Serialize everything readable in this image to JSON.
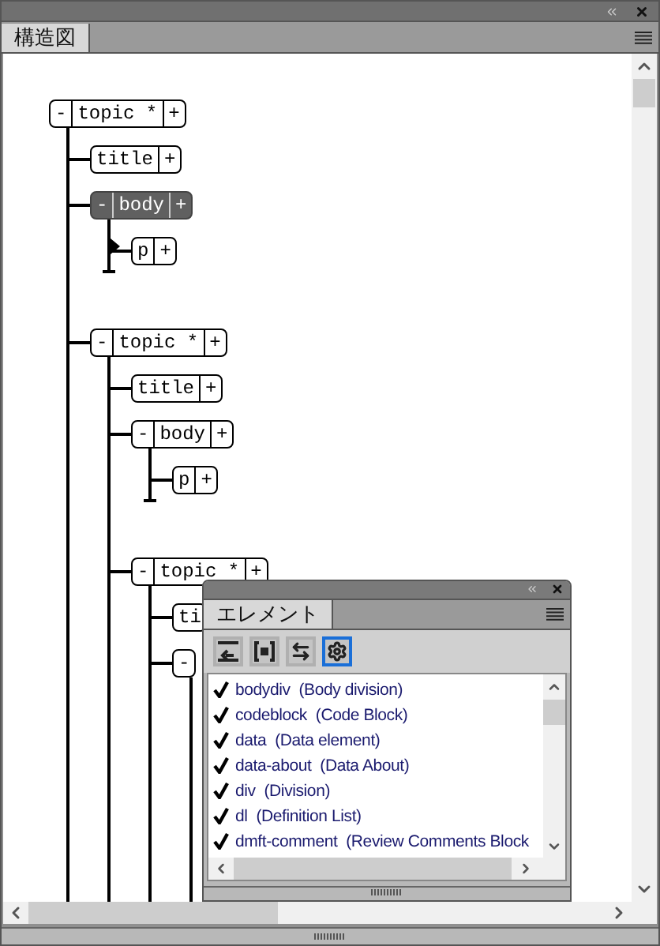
{
  "main_tab": {
    "label": "構造図",
    "selected": true
  },
  "tree": [
    {
      "toggle": "-",
      "label": "topic *",
      "add": "+",
      "selected": false,
      "children": [
        {
          "label": "title",
          "add": "+",
          "selected": false
        },
        {
          "toggle": "-",
          "label": "body",
          "add": "+",
          "selected": true,
          "children": [
            {
              "label": "p",
              "add": "+",
              "selected": false,
              "caret": true
            }
          ]
        },
        {
          "toggle": "-",
          "label": "topic *",
          "add": "+",
          "selected": false,
          "children": [
            {
              "label": "title",
              "add": "+",
              "selected": false
            },
            {
              "toggle": "-",
              "label": "body",
              "add": "+",
              "selected": false,
              "children": [
                {
                  "label": "p",
                  "add": "+",
                  "selected": false
                }
              ]
            },
            {
              "toggle": "-",
              "label": "topic *",
              "add": "+",
              "selected": false,
              "open_end": true,
              "children": [
                {
                  "label": "ti",
                  "selected": false
                },
                {
                  "toggle": "-",
                  "selected": false,
                  "open_end": true
                }
              ]
            }
          ]
        }
      ]
    }
  ],
  "panel": {
    "tab": {
      "label": "エレメント",
      "selected": true
    },
    "tools": [
      {
        "kind": "revert",
        "selected": false
      },
      {
        "kind": "bracket",
        "selected": false
      },
      {
        "kind": "swap",
        "selected": false
      },
      {
        "kind": "gear",
        "selected": true
      }
    ],
    "elements": [
      {
        "checked": true,
        "text": "bodydiv  (Body division)"
      },
      {
        "checked": true,
        "text": "codeblock  (Code Block)"
      },
      {
        "checked": true,
        "text": "data  (Data element)"
      },
      {
        "checked": true,
        "text": "data-about  (Data About)"
      },
      {
        "checked": true,
        "text": "div  (Division)"
      },
      {
        "checked": true,
        "text": "dl  (Definition List)"
      },
      {
        "checked": true,
        "text": "dmft-comment  (Review Comments Block"
      }
    ]
  }
}
